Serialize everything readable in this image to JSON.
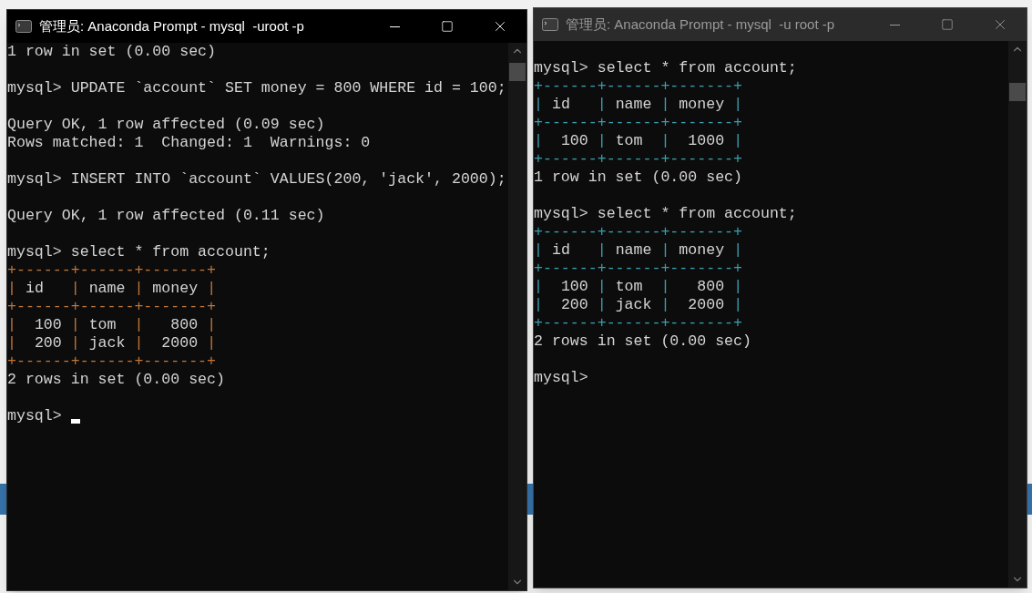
{
  "windows": [
    {
      "title": "管理员: Anaconda Prompt - mysql  -uroot -p",
      "active": true,
      "color": "#c0773a",
      "lines": [
        {
          "kind": "text",
          "text": "1 row in set (0.00 sec)"
        },
        {
          "kind": "blank"
        },
        {
          "kind": "text",
          "text": "mysql> UPDATE `account` SET money = 800 WHERE id = 100;"
        },
        {
          "kind": "blank"
        },
        {
          "kind": "text",
          "text": "Query OK, 1 row affected (0.09 sec)"
        },
        {
          "kind": "text",
          "text": "Rows matched: 1  Changed: 1  Warnings: 0"
        },
        {
          "kind": "blank"
        },
        {
          "kind": "text",
          "text": "mysql> INSERT INTO `account` VALUES(200, 'jack', 2000);"
        },
        {
          "kind": "blank"
        },
        {
          "kind": "text",
          "text": "Query OK, 1 row affected (0.11 sec)"
        },
        {
          "kind": "blank"
        },
        {
          "kind": "text",
          "text": "mysql> select * from account;"
        },
        {
          "kind": "table",
          "text": "+------+------+-------+"
        },
        {
          "kind": "table",
          "text": "| id   | name | money |"
        },
        {
          "kind": "table",
          "text": "+------+------+-------+"
        },
        {
          "kind": "table",
          "text": "|  100 | tom  |   800 |"
        },
        {
          "kind": "table",
          "text": "|  200 | jack |  2000 |"
        },
        {
          "kind": "table",
          "text": "+------+------+-------+"
        },
        {
          "kind": "text",
          "text": "2 rows in set (0.00 sec)"
        },
        {
          "kind": "blank"
        },
        {
          "kind": "prompt",
          "text": "mysql>",
          "cursor": true
        }
      ]
    },
    {
      "title": "管理员: Anaconda Prompt - mysql  -u root -p",
      "active": false,
      "color": "#3aa0b0",
      "lines": [
        {
          "kind": "blank"
        },
        {
          "kind": "text",
          "text": "mysql> select * from account;"
        },
        {
          "kind": "table",
          "text": "+------+------+-------+"
        },
        {
          "kind": "table",
          "text": "| id   | name | money |"
        },
        {
          "kind": "table",
          "text": "+------+------+-------+"
        },
        {
          "kind": "table",
          "text": "|  100 | tom  |  1000 |"
        },
        {
          "kind": "table",
          "text": "+------+------+-------+"
        },
        {
          "kind": "text",
          "text": "1 row in set (0.00 sec)"
        },
        {
          "kind": "blank"
        },
        {
          "kind": "text",
          "text": "mysql> select * from account;"
        },
        {
          "kind": "table",
          "text": "+------+------+-------+"
        },
        {
          "kind": "table",
          "text": "| id   | name | money |"
        },
        {
          "kind": "table",
          "text": "+------+------+-------+"
        },
        {
          "kind": "table",
          "text": "|  100 | tom  |   800 |"
        },
        {
          "kind": "table",
          "text": "|  200 | jack |  2000 |"
        },
        {
          "kind": "table",
          "text": "+------+------+-------+"
        },
        {
          "kind": "text",
          "text": "2 rows in set (0.00 sec)"
        },
        {
          "kind": "blank"
        },
        {
          "kind": "prompt",
          "text": "mysql>",
          "cursor": false
        }
      ]
    }
  ]
}
